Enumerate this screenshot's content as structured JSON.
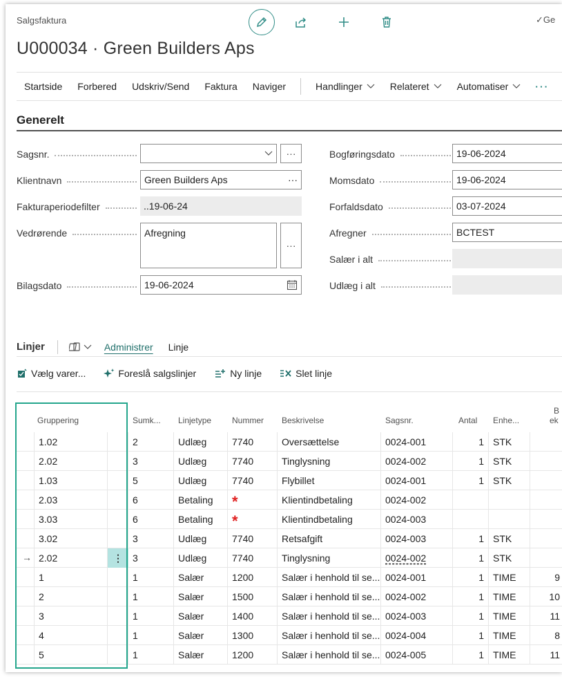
{
  "page": {
    "caption": "Salgsfaktura",
    "title": "U000034 · Green Builders Aps",
    "saved_status": "✓Ge"
  },
  "actionbar": {
    "items": [
      "Startside",
      "Forbered",
      "Udskriv/Send",
      "Faktura",
      "Naviger"
    ],
    "menus": [
      "Handlinger",
      "Relateret",
      "Automatiser"
    ],
    "more": "···"
  },
  "general": {
    "title": "Generelt",
    "sagsnr": {
      "label": "Sagsnr.",
      "value": ""
    },
    "klientnavn": {
      "label": "Klientnavn",
      "value": "Green Builders Aps"
    },
    "fakturaperiodefilter": {
      "label": "Fakturaperiodefilter",
      "value": "..19-06-24"
    },
    "vedrorende": {
      "label": "Vedrørende",
      "value": "Afregning"
    },
    "bilagsdato": {
      "label": "Bilagsdato",
      "value": "19-06-2024"
    },
    "bogforingsdato": {
      "label": "Bogføringsdato",
      "value": "19-06-2024"
    },
    "momsdato": {
      "label": "Momsdato",
      "value": "19-06-2024"
    },
    "forfaldsdato": {
      "label": "Forfaldsdato",
      "value": "03-07-2024"
    },
    "afregner": {
      "label": "Afregner",
      "value": "BCTEST"
    },
    "salaer_i_alt": {
      "label": "Salær i alt",
      "value": ""
    },
    "udlaeg_i_alt": {
      "label": "Udlæg i alt",
      "value": ""
    },
    "lookup_label": "···"
  },
  "lines": {
    "title": "Linjer",
    "tabs": [
      "Administrer",
      "Linje"
    ],
    "actions": [
      "Vælg varer...",
      "Foreslå salgslinjer",
      "Ny linje",
      "Slet linje"
    ],
    "columns": [
      "Gruppering",
      "Sumk...",
      "Linjetype",
      "Nummer",
      "Beskrivelse",
      "Sagsnr.",
      "Antal",
      "Enhe...",
      "B",
      "ek"
    ],
    "rows": [
      {
        "grp": "1.02",
        "sum": "2",
        "type": "Udlæg",
        "num": "7740",
        "desc": "Oversættelse",
        "sag": "0024-001",
        "antal": "1",
        "enhed": "STK",
        "extra": ""
      },
      {
        "grp": "2.02",
        "sum": "3",
        "type": "Udlæg",
        "num": "7740",
        "desc": "Tinglysning",
        "sag": "0024-002",
        "antal": "1",
        "enhed": "STK",
        "extra": ""
      },
      {
        "grp": "1.03",
        "sum": "5",
        "type": "Udlæg",
        "num": "7740",
        "desc": "Flybillet",
        "sag": "0024-001",
        "antal": "1",
        "enhed": "STK",
        "extra": ""
      },
      {
        "grp": "2.03",
        "sum": "6",
        "type": "Betaling",
        "num": "*",
        "desc": "Klientindbetaling",
        "sag": "0024-002",
        "antal": "",
        "enhed": "",
        "extra": ""
      },
      {
        "grp": "3.03",
        "sum": "6",
        "type": "Betaling",
        "num": "*",
        "desc": "Klientindbetaling",
        "sag": "0024-003",
        "antal": "",
        "enhed": "",
        "extra": ""
      },
      {
        "grp": "3.02",
        "sum": "3",
        "type": "Udlæg",
        "num": "7740",
        "desc": "Retsafgift",
        "sag": "0024-003",
        "antal": "1",
        "enhed": "STK",
        "extra": ""
      },
      {
        "grp": "2.02",
        "sum": "3",
        "type": "Udlæg",
        "num": "7740",
        "desc": "Tinglysning",
        "sag": "0024-002",
        "antal": "1",
        "enhed": "STK",
        "extra": ""
      },
      {
        "grp": "1",
        "sum": "1",
        "type": "Salær",
        "num": "1200",
        "desc": "Salær i henhold til se...",
        "sag": "0024-001",
        "antal": "1",
        "enhed": "TIME",
        "extra": "9"
      },
      {
        "grp": "2",
        "sum": "1",
        "type": "Salær",
        "num": "1500",
        "desc": "Salær i henhold til se...",
        "sag": "0024-002",
        "antal": "1",
        "enhed": "TIME",
        "extra": "10"
      },
      {
        "grp": "3",
        "sum": "1",
        "type": "Salær",
        "num": "1400",
        "desc": "Salær i henhold til se...",
        "sag": "0024-003",
        "antal": "1",
        "enhed": "TIME",
        "extra": "11"
      },
      {
        "grp": "4",
        "sum": "1",
        "type": "Salær",
        "num": "1300",
        "desc": "Salær i henhold til se...",
        "sag": "0024-004",
        "antal": "1",
        "enhed": "TIME",
        "extra": "8"
      },
      {
        "grp": "5",
        "sum": "1",
        "type": "Salær",
        "num": "1200",
        "desc": "Salær i henhold til se...",
        "sag": "0024-005",
        "antal": "1",
        "enhed": "TIME",
        "extra": "11"
      }
    ],
    "current_row_marker": "→",
    "row_menu": "⋮"
  },
  "colors": {
    "accent": "#2f8c86",
    "highlight": "#23a58c",
    "required": "#e02020"
  }
}
